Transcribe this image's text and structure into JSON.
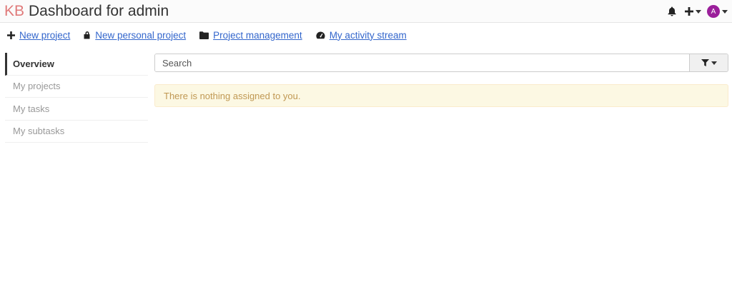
{
  "header": {
    "logo": "KB",
    "title": "Dashboard for admin",
    "avatar_initial": "A",
    "avatar_color": "#9b1f9b"
  },
  "actions": [
    {
      "label": "New project",
      "icon": "plus-icon"
    },
    {
      "label": "New personal project",
      "icon": "lock-icon"
    },
    {
      "label": "Project management",
      "icon": "folder-icon"
    },
    {
      "label": "My activity stream",
      "icon": "dashboard-gauge-icon"
    }
  ],
  "sidebar": {
    "items": [
      {
        "label": "Overview",
        "active": true
      },
      {
        "label": "My projects"
      },
      {
        "label": "My tasks"
      },
      {
        "label": "My subtasks"
      }
    ]
  },
  "search": {
    "placeholder": "Search",
    "value": ""
  },
  "alert": {
    "text": "There is nothing assigned to you."
  },
  "colors": {
    "link": "#3366cc",
    "logo": "#e07a7a",
    "alert_bg": "#fcf8e3",
    "alert_text": "#c09853"
  }
}
